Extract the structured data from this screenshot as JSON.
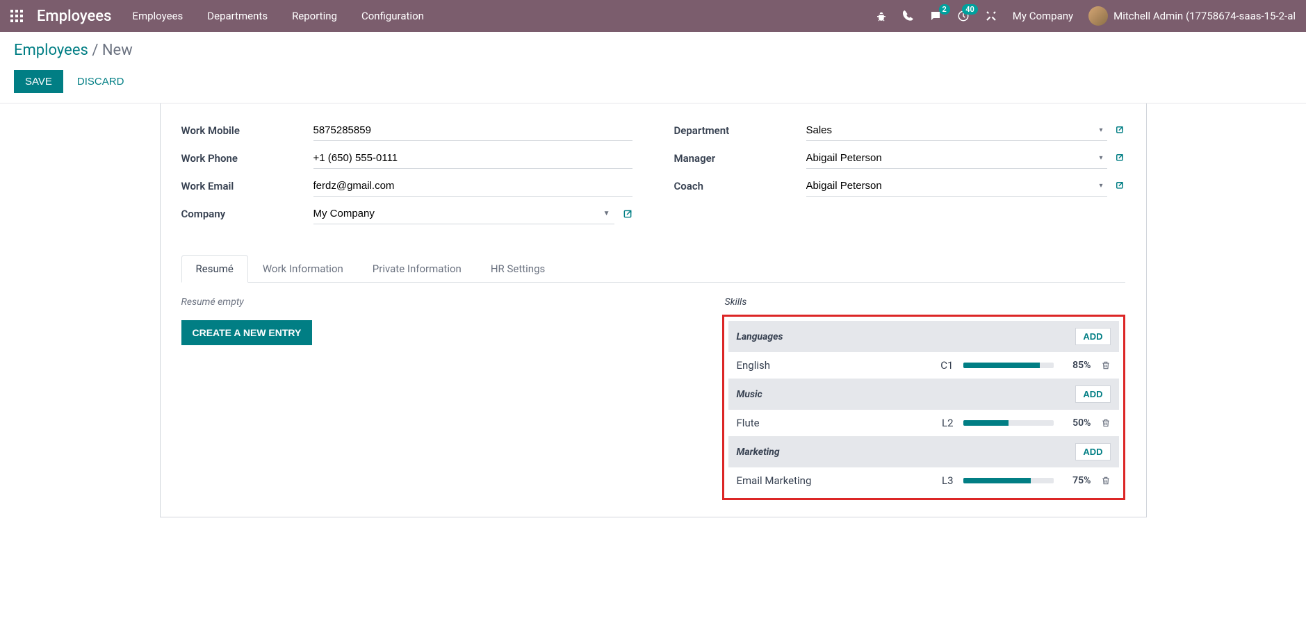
{
  "nav": {
    "brand": "Employees",
    "menu": [
      "Employees",
      "Departments",
      "Reporting",
      "Configuration"
    ],
    "messages_badge": "2",
    "activities_badge": "40",
    "company": "My Company",
    "user": "Mitchell Admin (17758674-saas-15-2-al"
  },
  "breadcrumb": {
    "root": "Employees",
    "current": "New"
  },
  "actions": {
    "save": "SAVE",
    "discard": "DISCARD"
  },
  "form": {
    "left": [
      {
        "label": "Work Mobile",
        "value": "5875285859",
        "type": "text"
      },
      {
        "label": "Work Phone",
        "value": "+1 (650) 555-0111",
        "type": "text"
      },
      {
        "label": "Work Email",
        "value": "ferdz@gmail.com",
        "type": "text"
      },
      {
        "label": "Company",
        "value": "My Company",
        "type": "m2o"
      }
    ],
    "right": [
      {
        "label": "Department",
        "value": "Sales",
        "type": "m2o"
      },
      {
        "label": "Manager",
        "value": "Abigail Peterson",
        "type": "m2o"
      },
      {
        "label": "Coach",
        "value": "Abigail Peterson",
        "type": "m2o"
      }
    ]
  },
  "tabs": [
    "Resumé",
    "Work Information",
    "Private Information",
    "HR Settings"
  ],
  "resume": {
    "empty_text": "Resumé empty",
    "create_button": "CREATE A NEW ENTRY"
  },
  "skills": {
    "title": "Skills",
    "add_label": "ADD",
    "groups": [
      {
        "name": "Languages",
        "items": [
          {
            "skill": "English",
            "level": "C1",
            "pct": 85
          }
        ]
      },
      {
        "name": "Music",
        "items": [
          {
            "skill": "Flute",
            "level": "L2",
            "pct": 50
          }
        ]
      },
      {
        "name": "Marketing",
        "items": [
          {
            "skill": "Email Marketing",
            "level": "L3",
            "pct": 75
          }
        ]
      }
    ]
  }
}
